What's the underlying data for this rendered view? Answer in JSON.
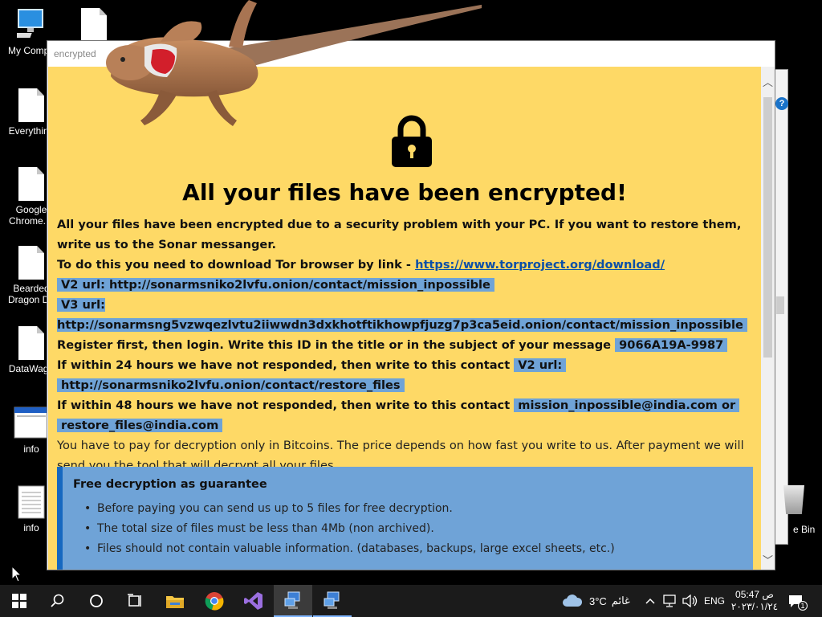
{
  "desktop": {
    "icons": [
      {
        "label": "My Compu"
      },
      {
        "label": ""
      },
      {
        "label": "Everything"
      },
      {
        "label": "Google\nChrome.In"
      },
      {
        "label": "Bearded\nDragon De"
      },
      {
        "label": "DataWago"
      },
      {
        "label": "info"
      },
      {
        "label": "info"
      }
    ],
    "recycle_label": "e Bin"
  },
  "window": {
    "title": "encrypted",
    "headline": "All your files have been encrypted!",
    "p1": "All your files have been encrypted due to a security problem with your PC. If you want to restore them, write us to the Sonar messanger.",
    "p2_prefix": "To do this you need to download Tor browser by link - ",
    "tor_link": "https://www.torproject.org/download/",
    "v2_url": "V2 url: http://sonarmsniko2lvfu.onion/contact/mission_inpossible",
    "v3_url": "V3 url: http://sonarmsng5vzwqezlvtu2iiwwdn3dxkhotftikhowpfjuzg7p3ca5eid.onion/contact/mission_inpossible",
    "register_text": "Register first, then login. Write this ID in the title or in the subject of your message",
    "id_value": "9066A19A-9987",
    "h24_text": "If within 24 hours we have not responded, then write to this contact",
    "h24_contact_a": "V2 url:",
    "h24_contact_b": "http://sonarmsniko2lvfu.onion/contact/restore_files",
    "h48_text": "If within 48 hours we have not responded, then write to this contact",
    "h48_contact_a": "mission_inpossible@india.com or",
    "h48_contact_b": "restore_files@india.com",
    "pay_text": "You have to pay for decryption only in Bitcoins. The price depends on how fast you write to us. After payment we will send you the tool that will decrypt all your files.",
    "guarantee_title": "Free decryption as guarantee",
    "guarantee_items": [
      "Before paying you can send us up to 5 files for free decryption.",
      "The total size of files must be less than 4Mb (non archived).",
      "Files should not contain valuable information. (databases, backups, large excel sheets, etc.)"
    ]
  },
  "taskbar": {
    "weather_temp": "3°C",
    "weather_desc": "غائم",
    "lang": "ENG",
    "time": "05:47 ص",
    "date": "٢٠٢٣/٠١/٢٤",
    "notif_count": "1"
  },
  "colors": {
    "note_bg": "#fed966",
    "highlight": "#6fa3d7",
    "guarantee_border": "#1668c0",
    "taskbar": "#1b1b1b"
  }
}
